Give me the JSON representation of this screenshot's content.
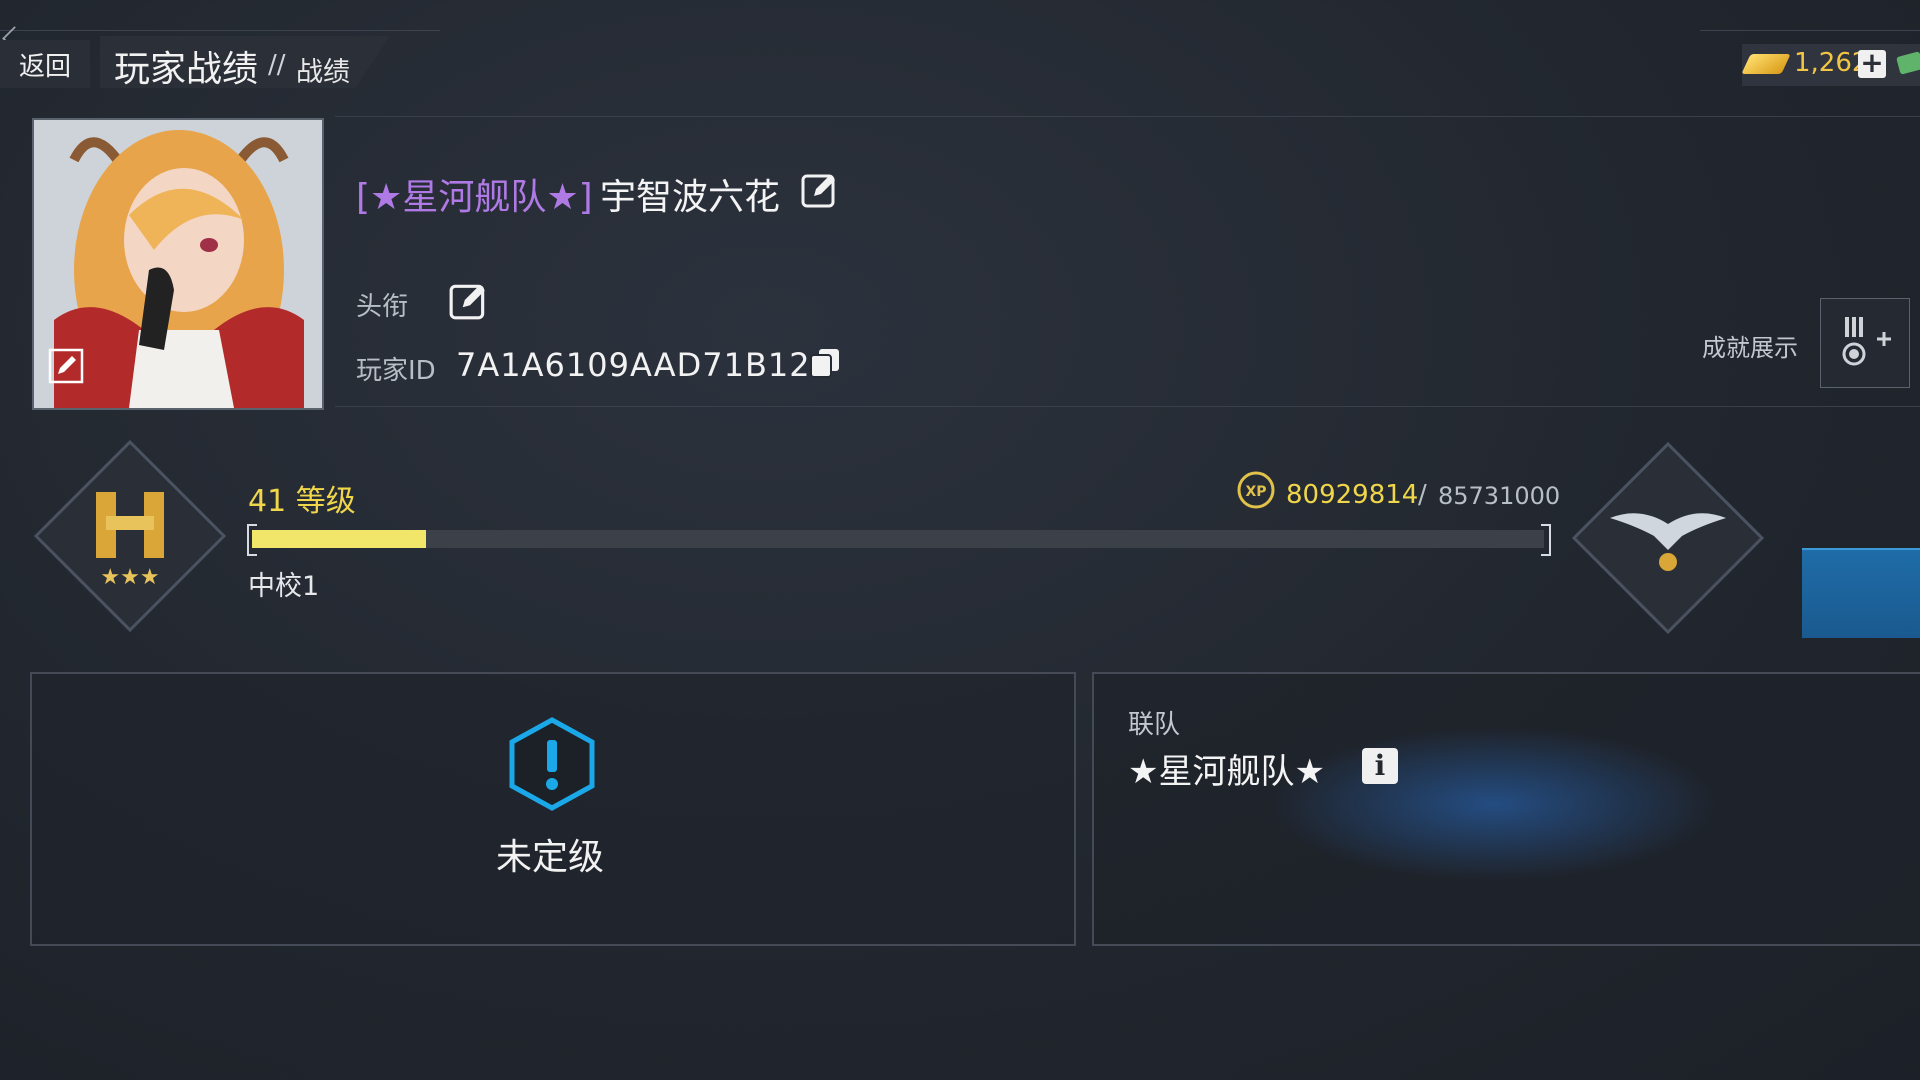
{
  "top": {
    "back_label": "返回",
    "title": "玩家战绩",
    "separator": "//",
    "subtitle": "战绩",
    "currency": {
      "icon": "gold-bar-icon",
      "value": "1,262",
      "plus": "+"
    }
  },
  "profile": {
    "clan_tag": "[★星河舰队★]",
    "name": "宇智波六花",
    "title_label": "头衔",
    "id_label": "玩家ID",
    "id_value": "7A1A6109AAD71B12",
    "achievement_label": "成就展示"
  },
  "level": {
    "level_text": "41 等级",
    "rank_name": "中校1",
    "xp_current": "80929814",
    "xp_separator": "/",
    "xp_max": "85731000",
    "progress_fraction": 0.135
  },
  "panels": {
    "ranked_status": "未定级",
    "team_label": "联队",
    "team_name": "★星河舰队★",
    "info_glyph": "i"
  },
  "colors": {
    "accent_yellow": "#f0d64a",
    "clan_purple": "#b07ae6",
    "warning_blue": "#1aa8e8"
  }
}
